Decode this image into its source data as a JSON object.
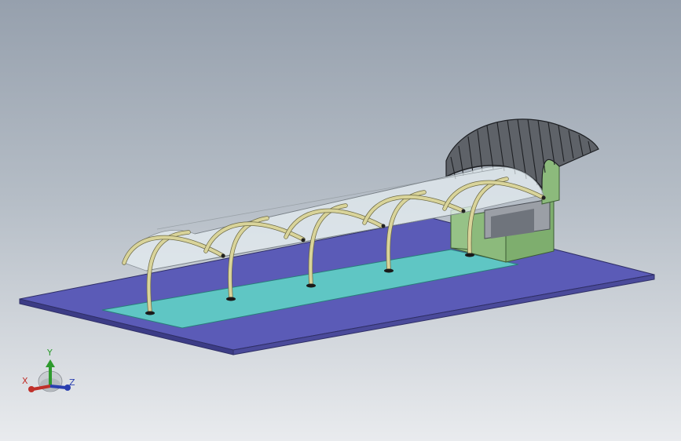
{
  "view": {
    "type": "3d-model-viewport",
    "background_top": "#96a0ad",
    "background_bottom": "#e9ebee"
  },
  "model": {
    "base_plate_color": "#5b5bb7",
    "inner_pad_color": "#5fc6c4",
    "canopy_frame_color": "#d9d49a",
    "canopy_glazing_color": "#e6eef2",
    "booth_color": "#8cba7c",
    "booth_roof_color": "#5e6268",
    "arch_count": 5
  },
  "triad": {
    "x_label": "X",
    "y_label": "Y",
    "z_label": "Z",
    "x_color": "#c0302a",
    "y_color": "#2e9a2e",
    "z_color": "#2a3fb0"
  }
}
